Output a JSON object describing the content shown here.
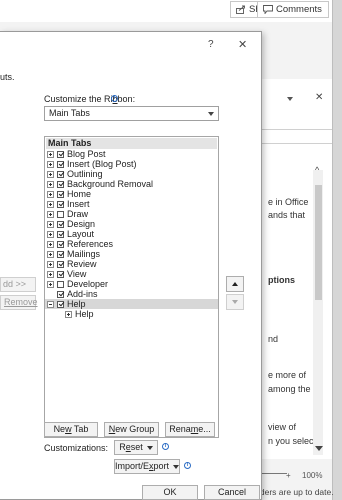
{
  "toolbar": {
    "share_label": "Share",
    "comments_label": "Comments"
  },
  "pane": {
    "lines": [
      "e in Office",
      "ands that",
      "ptions",
      "nd",
      "e more of",
      "among the",
      "view of",
      "n you select"
    ],
    "zoom_minus": "-",
    "zoom_plus": "+",
    "zoom_level": "100%",
    "status_text": "lders are up to date."
  },
  "dialog": {
    "help_glyph": "?",
    "close_glyph": "✕",
    "left_desc": "uts.",
    "customize_label_pre": "Customize the Ri",
    "customize_label_ul": "b",
    "customize_label_post": "bon:",
    "ribbon_combo_value": "Main Tabs",
    "tree_header": "Main Tabs",
    "tree_items": [
      {
        "label": "Blog Post",
        "expander": "plus",
        "checked": true
      },
      {
        "label": "Insert (Blog Post)",
        "expander": "plus",
        "checked": true
      },
      {
        "label": "Outlining",
        "expander": "plus",
        "checked": true
      },
      {
        "label": "Background Removal",
        "expander": "plus",
        "checked": true
      },
      {
        "label": "Home",
        "expander": "plus",
        "checked": true
      },
      {
        "label": "Insert",
        "expander": "plus",
        "checked": true
      },
      {
        "label": "Draw",
        "expander": "plus",
        "checked": false
      },
      {
        "label": "Design",
        "expander": "plus",
        "checked": true
      },
      {
        "label": "Layout",
        "expander": "plus",
        "checked": true
      },
      {
        "label": "References",
        "expander": "plus",
        "checked": true
      },
      {
        "label": "Mailings",
        "expander": "plus",
        "checked": true
      },
      {
        "label": "Review",
        "expander": "plus",
        "checked": true
      },
      {
        "label": "View",
        "expander": "plus",
        "checked": true
      },
      {
        "label": "Developer",
        "expander": "plus",
        "checked": false
      },
      {
        "label": "Add-ins",
        "expander": "none",
        "checked": true
      },
      {
        "label": "Help",
        "expander": "minus",
        "checked": true,
        "selected": true
      },
      {
        "label": "Help",
        "expander": "plus",
        "child": true
      }
    ],
    "add_button": "dd >>",
    "remove_button": "Remove",
    "new_tab_pre": "Ne",
    "new_tab_ul": "w",
    "new_tab_post": " Tab",
    "new_group_ul": "N",
    "new_group_post": "ew Group",
    "rename_pre": "Rena",
    "rename_ul": "m",
    "rename_post": "e...",
    "customizations_label": "Customizations:",
    "reset_pre": "R",
    "reset_ul": "e",
    "reset_post": "set",
    "import_export_pre": "Import/E",
    "import_export_ul": "x",
    "import_export_post": "port",
    "ok_button": "OK",
    "cancel_button": "Cancel"
  },
  "colors": {
    "accent": "#2b6cc4",
    "selection": "#d7d7d7"
  }
}
